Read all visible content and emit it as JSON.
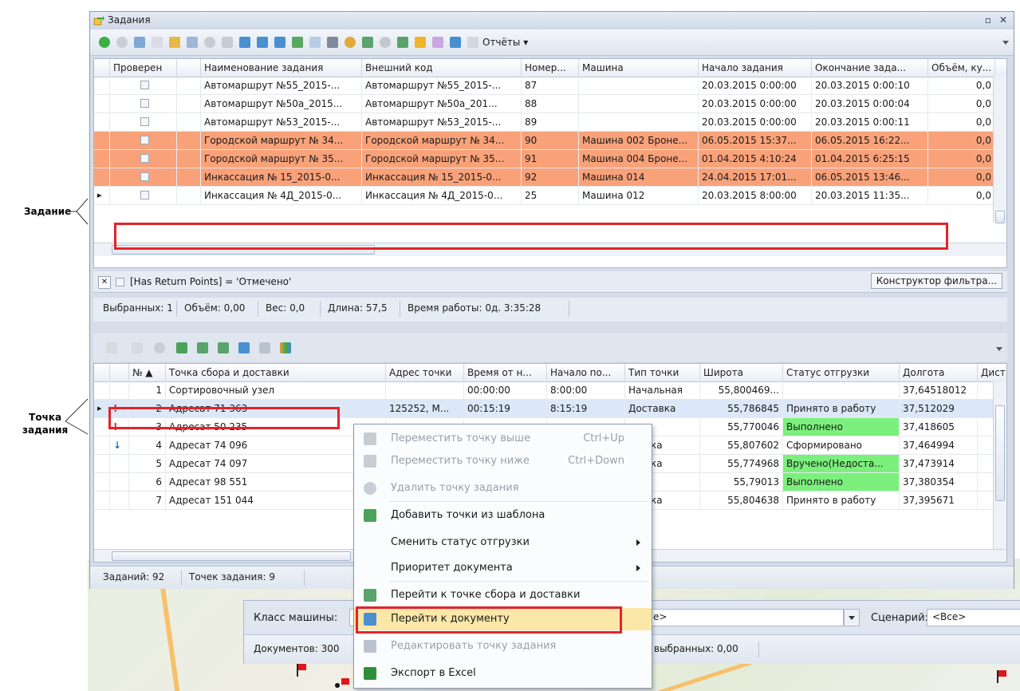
{
  "annotations": {
    "task_label": "Задание",
    "point_label_1": "Точка",
    "point_label_2": "задания"
  },
  "window": {
    "title": "Задания",
    "close_glyph": "✕",
    "restore_glyph": "▫"
  },
  "toolbar": {
    "reports_label": "Отчёты ▾"
  },
  "tasks": {
    "columns": [
      "Проверен",
      "Наименование задания",
      "Внешний код",
      "Номер...",
      "Машина",
      "Начало задания",
      "Окончание зада...",
      "Объём, ку..."
    ],
    "rows": [
      {
        "name": "Автомаршрут №55_2015-...",
        "ext": "Автомаршрут №55_2015-...",
        "num": "87",
        "car": "",
        "start": "20.03.2015 0:00:00",
        "end": "20.03.2015 0:00:10",
        "vol": "0,0",
        "highlight": false
      },
      {
        "name": "Автомаршрут №50а_2015...",
        "ext": "Автомаршрут №50а_201...",
        "num": "88",
        "car": "",
        "start": "20.03.2015 0:00:00",
        "end": "20.03.2015 0:00:04",
        "vol": "0,0",
        "highlight": false
      },
      {
        "name": "Автомаршрут №53_2015-...",
        "ext": "Автомаршрут №53_2015-...",
        "num": "89",
        "car": "",
        "start": "20.03.2015 0:00:00",
        "end": "20.03.2015 0:00:11",
        "vol": "0,0",
        "highlight": false
      },
      {
        "name": "Городской маршрут № 34...",
        "ext": "Городской маршрут № 34...",
        "num": "90",
        "car": "Машина 002 Броне...",
        "start": "06.05.2015 15:37...",
        "end": "06.05.2015 16:22...",
        "vol": "0,0",
        "highlight": true
      },
      {
        "name": "Городской маршрут № 35...",
        "ext": "Городской маршрут № 35...",
        "num": "91",
        "car": "Машина 004 Броне...",
        "start": "01.04.2015 4:10:24",
        "end": "01.04.2015 6:25:15",
        "vol": "0,0",
        "highlight": true
      },
      {
        "name": "Инкассация № 15_2015-0...",
        "ext": "Инкассация № 15_2015-0...",
        "num": "92",
        "car": "Машина 014",
        "start": "24.04.2015 17:01...",
        "end": "06.05.2015 13:46...",
        "vol": "0,0",
        "highlight": true
      },
      {
        "name": "Инкассация № 4Д_2015-0...",
        "ext": "Инкассация № 4Д_2015-0...",
        "num": "25",
        "car": "Машина 012",
        "start": "20.03.2015 8:00:00",
        "end": "20.03.2015 11:35...",
        "vol": "0,0",
        "highlight": false
      }
    ]
  },
  "filter": {
    "text": "[Has Return Points] = 'Отмечено'",
    "builder": "Конструктор фильтра..."
  },
  "summary": {
    "selected": "Выбранных: 1",
    "volume": "Объём: 0,00",
    "weight": "Вес: 0,0",
    "length": "Длина: 57,5",
    "worktime": "Время работы: 0д. 3:35:28"
  },
  "points": {
    "columns": [
      "№ ▲",
      "Точка сбора и доставки",
      "Адрес точки",
      "Время от н...",
      "Начало по...",
      "Тип точки",
      "Широта",
      "Статус отгрузки",
      "Долгота",
      "Дист"
    ],
    "rows": [
      {
        "flag": "",
        "no": "1",
        "name": "Сортировочный узел",
        "addr": "",
        "t": "00:00:00",
        "start": "8:00:00",
        "type": "Начальная",
        "lat": "55,800469...",
        "status": "",
        "lon": "37,64518012",
        "green": false
      },
      {
        "flag": "!",
        "no": "2",
        "name": "Адресат 71 363",
        "addr": "125252, М...",
        "t": "00:15:19",
        "start": "8:15:19",
        "type": "Доставка",
        "lat": "55,786845",
        "status": "Принято в работу",
        "lon": "37,512029",
        "green": false
      },
      {
        "flag": "!",
        "no": "3",
        "name": "Адресат 50 235",
        "addr": "",
        "t": "",
        "start": "",
        "type": "о",
        "lat": "55,770046",
        "status": "Выполнено",
        "lon": "37,418605",
        "green": true
      },
      {
        "flag": "↓",
        "no": "4",
        "name": "Адресат 74 096",
        "addr": "",
        "t": "",
        "start": "",
        "type": "ставка",
        "lat": "55,807602",
        "status": "Сформировано",
        "lon": "37,464994",
        "green": false
      },
      {
        "flag": "",
        "no": "5",
        "name": "Адресат 74 097",
        "addr": "",
        "t": "",
        "start": "",
        "type": "ставка",
        "lat": "55,774968",
        "status": "Вручено(Недоста...",
        "lon": "37,473914",
        "green": true
      },
      {
        "flag": "",
        "no": "6",
        "name": "Адресат 98 551",
        "addr": "",
        "t": "",
        "start": "",
        "type": "о",
        "lat": "55,79013",
        "status": "Выполнено",
        "lon": "37,380354",
        "green": true
      },
      {
        "flag": "",
        "no": "7",
        "name": "Адресат 151 044",
        "addr": "",
        "t": "",
        "start": "",
        "type": "ставка",
        "lat": "55,804638",
        "status": "Принято в работу",
        "lon": "37,395671",
        "green": false
      }
    ]
  },
  "footer": {
    "tasks": "Заданий: 92",
    "points": "Точек задания: 9"
  },
  "background": {
    "car_class_label": "Класс машины:",
    "car_class_value": "е>",
    "scenario_label": "Сценарий:",
    "scenario_value": "<Все>",
    "docs": "Документов: 300",
    "selected_sum": "выбранных: 0,00"
  },
  "context_menu": [
    {
      "label": "Переместить точку выше",
      "shortcut": "Ctrl+Up",
      "disabled": true,
      "icon": "arrow-up-icon"
    },
    {
      "label": "Переместить точку ниже",
      "shortcut": "Ctrl+Down",
      "disabled": true,
      "icon": "arrow-down-icon"
    },
    {
      "label": "Удалить точку задания",
      "shortcut": "",
      "disabled": true,
      "icon": "delete-icon"
    },
    {
      "label": "Добавить точки из шаблона",
      "shortcut": "",
      "disabled": false,
      "icon": "template-icon"
    },
    {
      "label": "Сменить статус отгрузки",
      "shortcut": "",
      "disabled": false,
      "icon": "",
      "submenu": true
    },
    {
      "label": "Приоритет документа",
      "shortcut": "",
      "disabled": false,
      "icon": "",
      "submenu": true
    },
    {
      "label": "Перейти к точке сбора и доставки",
      "shortcut": "",
      "disabled": false,
      "icon": "goto-point-icon"
    },
    {
      "label": "Перейти к документу",
      "shortcut": "",
      "disabled": false,
      "icon": "goto-document-icon"
    },
    {
      "label": "Редактировать точку задания",
      "shortcut": "",
      "disabled": true,
      "icon": "edit-icon"
    },
    {
      "label": "Экспорт в Excel",
      "shortcut": "",
      "disabled": false,
      "icon": "excel-icon"
    }
  ],
  "colors": {
    "highlight_row": "#f9a27a",
    "status_green": "#7cf07c",
    "selection_box": "#e3232a"
  }
}
